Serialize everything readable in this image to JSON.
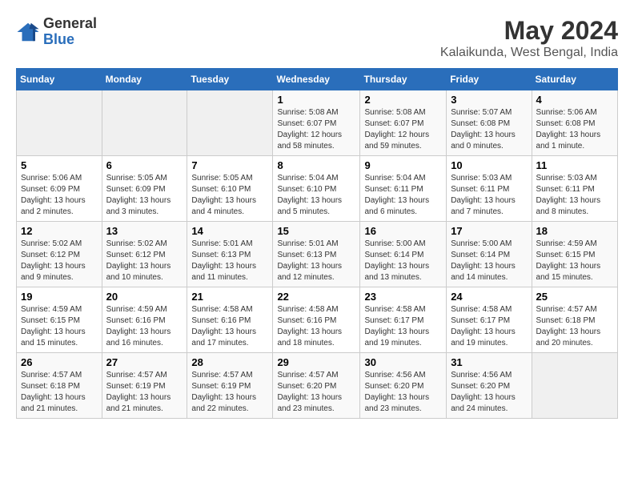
{
  "logo": {
    "general": "General",
    "blue": "Blue"
  },
  "title": "May 2024",
  "subtitle": "Kalaikunda, West Bengal, India",
  "days_of_week": [
    "Sunday",
    "Monday",
    "Tuesday",
    "Wednesday",
    "Thursday",
    "Friday",
    "Saturday"
  ],
  "weeks": [
    [
      {
        "day": "",
        "info": ""
      },
      {
        "day": "",
        "info": ""
      },
      {
        "day": "",
        "info": ""
      },
      {
        "day": "1",
        "info": "Sunrise: 5:08 AM\nSunset: 6:07 PM\nDaylight: 12 hours and 58 minutes."
      },
      {
        "day": "2",
        "info": "Sunrise: 5:08 AM\nSunset: 6:07 PM\nDaylight: 12 hours and 59 minutes."
      },
      {
        "day": "3",
        "info": "Sunrise: 5:07 AM\nSunset: 6:08 PM\nDaylight: 13 hours and 0 minutes."
      },
      {
        "day": "4",
        "info": "Sunrise: 5:06 AM\nSunset: 6:08 PM\nDaylight: 13 hours and 1 minute."
      }
    ],
    [
      {
        "day": "5",
        "info": "Sunrise: 5:06 AM\nSunset: 6:09 PM\nDaylight: 13 hours and 2 minutes."
      },
      {
        "day": "6",
        "info": "Sunrise: 5:05 AM\nSunset: 6:09 PM\nDaylight: 13 hours and 3 minutes."
      },
      {
        "day": "7",
        "info": "Sunrise: 5:05 AM\nSunset: 6:10 PM\nDaylight: 13 hours and 4 minutes."
      },
      {
        "day": "8",
        "info": "Sunrise: 5:04 AM\nSunset: 6:10 PM\nDaylight: 13 hours and 5 minutes."
      },
      {
        "day": "9",
        "info": "Sunrise: 5:04 AM\nSunset: 6:11 PM\nDaylight: 13 hours and 6 minutes."
      },
      {
        "day": "10",
        "info": "Sunrise: 5:03 AM\nSunset: 6:11 PM\nDaylight: 13 hours and 7 minutes."
      },
      {
        "day": "11",
        "info": "Sunrise: 5:03 AM\nSunset: 6:11 PM\nDaylight: 13 hours and 8 minutes."
      }
    ],
    [
      {
        "day": "12",
        "info": "Sunrise: 5:02 AM\nSunset: 6:12 PM\nDaylight: 13 hours and 9 minutes."
      },
      {
        "day": "13",
        "info": "Sunrise: 5:02 AM\nSunset: 6:12 PM\nDaylight: 13 hours and 10 minutes."
      },
      {
        "day": "14",
        "info": "Sunrise: 5:01 AM\nSunset: 6:13 PM\nDaylight: 13 hours and 11 minutes."
      },
      {
        "day": "15",
        "info": "Sunrise: 5:01 AM\nSunset: 6:13 PM\nDaylight: 13 hours and 12 minutes."
      },
      {
        "day": "16",
        "info": "Sunrise: 5:00 AM\nSunset: 6:14 PM\nDaylight: 13 hours and 13 minutes."
      },
      {
        "day": "17",
        "info": "Sunrise: 5:00 AM\nSunset: 6:14 PM\nDaylight: 13 hours and 14 minutes."
      },
      {
        "day": "18",
        "info": "Sunrise: 4:59 AM\nSunset: 6:15 PM\nDaylight: 13 hours and 15 minutes."
      }
    ],
    [
      {
        "day": "19",
        "info": "Sunrise: 4:59 AM\nSunset: 6:15 PM\nDaylight: 13 hours and 15 minutes."
      },
      {
        "day": "20",
        "info": "Sunrise: 4:59 AM\nSunset: 6:16 PM\nDaylight: 13 hours and 16 minutes."
      },
      {
        "day": "21",
        "info": "Sunrise: 4:58 AM\nSunset: 6:16 PM\nDaylight: 13 hours and 17 minutes."
      },
      {
        "day": "22",
        "info": "Sunrise: 4:58 AM\nSunset: 6:16 PM\nDaylight: 13 hours and 18 minutes."
      },
      {
        "day": "23",
        "info": "Sunrise: 4:58 AM\nSunset: 6:17 PM\nDaylight: 13 hours and 19 minutes."
      },
      {
        "day": "24",
        "info": "Sunrise: 4:58 AM\nSunset: 6:17 PM\nDaylight: 13 hours and 19 minutes."
      },
      {
        "day": "25",
        "info": "Sunrise: 4:57 AM\nSunset: 6:18 PM\nDaylight: 13 hours and 20 minutes."
      }
    ],
    [
      {
        "day": "26",
        "info": "Sunrise: 4:57 AM\nSunset: 6:18 PM\nDaylight: 13 hours and 21 minutes."
      },
      {
        "day": "27",
        "info": "Sunrise: 4:57 AM\nSunset: 6:19 PM\nDaylight: 13 hours and 21 minutes."
      },
      {
        "day": "28",
        "info": "Sunrise: 4:57 AM\nSunset: 6:19 PM\nDaylight: 13 hours and 22 minutes."
      },
      {
        "day": "29",
        "info": "Sunrise: 4:57 AM\nSunset: 6:20 PM\nDaylight: 13 hours and 23 minutes."
      },
      {
        "day": "30",
        "info": "Sunrise: 4:56 AM\nSunset: 6:20 PM\nDaylight: 13 hours and 23 minutes."
      },
      {
        "day": "31",
        "info": "Sunrise: 4:56 AM\nSunset: 6:20 PM\nDaylight: 13 hours and 24 minutes."
      },
      {
        "day": "",
        "info": ""
      }
    ]
  ]
}
